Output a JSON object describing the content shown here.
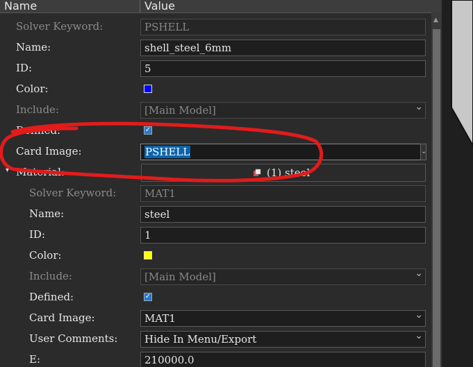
{
  "header": {
    "name_col": "Name",
    "value_col": "Value"
  },
  "rows": [
    {
      "label": "Solver Keyword:",
      "value": "PSHELL"
    },
    {
      "label": "Name:",
      "value": "shell_steel_6mm"
    },
    {
      "label": "ID:",
      "value": "5"
    },
    {
      "label": "Color:",
      "color": "#0000ff"
    },
    {
      "label": "Include:",
      "value": "[Main Model]"
    },
    {
      "label": "Defined:",
      "checked": "✓"
    },
    {
      "label": "Card Image:",
      "value": "PSHELL"
    },
    {
      "label": "Material:",
      "value": "(1) steel",
      "expand_arrow": "▾"
    }
  ],
  "material": [
    {
      "label": "Solver Keyword:",
      "value": "MAT1"
    },
    {
      "label": "Name:",
      "value": "steel"
    },
    {
      "label": "ID:",
      "value": "1"
    },
    {
      "label": "Color:",
      "color": "#ffff00"
    },
    {
      "label": "Include:",
      "value": "[Main Model]"
    },
    {
      "label": "Defined:",
      "checked": "✓"
    },
    {
      "label": "Card Image:",
      "value": "MAT1"
    },
    {
      "label": "User Comments:",
      "value": "Hide In Menu/Export"
    },
    {
      "label": "E:",
      "value": "210000.0"
    }
  ],
  "colors": {
    "annotation": "#e31b1b",
    "selection": "#0a64ad"
  }
}
